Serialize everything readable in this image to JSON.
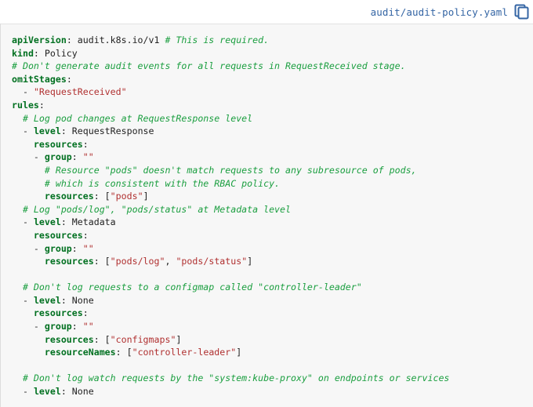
{
  "header": {
    "filename": "audit/audit-policy.yaml",
    "copy_label": "copy-to-clipboard",
    "filename_color": "#3465a4",
    "copy_icon_color": "#3465a4"
  },
  "code": {
    "language": "yaml",
    "background": "#f7f7f7",
    "colors": {
      "key": "#007020",
      "comment": "#1a9e3f",
      "string": "#b03030",
      "plain": "#222222"
    },
    "lines": [
      {
        "indent": 0,
        "tokens": [
          {
            "t": "key",
            "v": "apiVersion"
          },
          {
            "t": "plain",
            "v": ": audit.k8s.io/v1 "
          },
          {
            "t": "comment",
            "v": "# This is required."
          }
        ]
      },
      {
        "indent": 0,
        "tokens": [
          {
            "t": "key",
            "v": "kind"
          },
          {
            "t": "plain",
            "v": ": Policy"
          }
        ]
      },
      {
        "indent": 0,
        "tokens": [
          {
            "t": "comment",
            "v": "# Don't generate audit events for all requests in RequestReceived stage."
          }
        ]
      },
      {
        "indent": 0,
        "tokens": [
          {
            "t": "key",
            "v": "omitStages"
          },
          {
            "t": "plain",
            "v": ":"
          }
        ]
      },
      {
        "indent": 2,
        "tokens": [
          {
            "t": "punct",
            "v": "- "
          },
          {
            "t": "string",
            "v": "\"RequestReceived\""
          }
        ]
      },
      {
        "indent": 0,
        "tokens": [
          {
            "t": "key",
            "v": "rules"
          },
          {
            "t": "plain",
            "v": ":"
          }
        ]
      },
      {
        "indent": 2,
        "tokens": [
          {
            "t": "comment",
            "v": "# Log pod changes at RequestResponse level"
          }
        ]
      },
      {
        "indent": 2,
        "tokens": [
          {
            "t": "punct",
            "v": "- "
          },
          {
            "t": "key",
            "v": "level"
          },
          {
            "t": "plain",
            "v": ": RequestResponse"
          }
        ]
      },
      {
        "indent": 4,
        "tokens": [
          {
            "t": "key",
            "v": "resources"
          },
          {
            "t": "plain",
            "v": ":"
          }
        ]
      },
      {
        "indent": 4,
        "tokens": [
          {
            "t": "punct",
            "v": "- "
          },
          {
            "t": "key",
            "v": "group"
          },
          {
            "t": "plain",
            "v": ": "
          },
          {
            "t": "string",
            "v": "\"\""
          }
        ]
      },
      {
        "indent": 6,
        "tokens": [
          {
            "t": "comment",
            "v": "# Resource \"pods\" doesn't match requests to any subresource of pods,"
          }
        ]
      },
      {
        "indent": 6,
        "tokens": [
          {
            "t": "comment",
            "v": "# which is consistent with the RBAC policy."
          }
        ]
      },
      {
        "indent": 6,
        "tokens": [
          {
            "t": "key",
            "v": "resources"
          },
          {
            "t": "plain",
            "v": ": ["
          },
          {
            "t": "string",
            "v": "\"pods\""
          },
          {
            "t": "plain",
            "v": "]"
          }
        ]
      },
      {
        "indent": 2,
        "tokens": [
          {
            "t": "comment",
            "v": "# Log \"pods/log\", \"pods/status\" at Metadata level"
          }
        ]
      },
      {
        "indent": 2,
        "tokens": [
          {
            "t": "punct",
            "v": "- "
          },
          {
            "t": "key",
            "v": "level"
          },
          {
            "t": "plain",
            "v": ": Metadata"
          }
        ]
      },
      {
        "indent": 4,
        "tokens": [
          {
            "t": "key",
            "v": "resources"
          },
          {
            "t": "plain",
            "v": ":"
          }
        ]
      },
      {
        "indent": 4,
        "tokens": [
          {
            "t": "punct",
            "v": "- "
          },
          {
            "t": "key",
            "v": "group"
          },
          {
            "t": "plain",
            "v": ": "
          },
          {
            "t": "string",
            "v": "\"\""
          }
        ]
      },
      {
        "indent": 6,
        "tokens": [
          {
            "t": "key",
            "v": "resources"
          },
          {
            "t": "plain",
            "v": ": ["
          },
          {
            "t": "string",
            "v": "\"pods/log\""
          },
          {
            "t": "plain",
            "v": ", "
          },
          {
            "t": "string",
            "v": "\"pods/status\""
          },
          {
            "t": "plain",
            "v": "]"
          }
        ]
      },
      {
        "indent": 0,
        "tokens": []
      },
      {
        "indent": 2,
        "tokens": [
          {
            "t": "comment",
            "v": "# Don't log requests to a configmap called \"controller-leader\""
          }
        ]
      },
      {
        "indent": 2,
        "tokens": [
          {
            "t": "punct",
            "v": "- "
          },
          {
            "t": "key",
            "v": "level"
          },
          {
            "t": "plain",
            "v": ": None"
          }
        ]
      },
      {
        "indent": 4,
        "tokens": [
          {
            "t": "key",
            "v": "resources"
          },
          {
            "t": "plain",
            "v": ":"
          }
        ]
      },
      {
        "indent": 4,
        "tokens": [
          {
            "t": "punct",
            "v": "- "
          },
          {
            "t": "key",
            "v": "group"
          },
          {
            "t": "plain",
            "v": ": "
          },
          {
            "t": "string",
            "v": "\"\""
          }
        ]
      },
      {
        "indent": 6,
        "tokens": [
          {
            "t": "key",
            "v": "resources"
          },
          {
            "t": "plain",
            "v": ": ["
          },
          {
            "t": "string",
            "v": "\"configmaps\""
          },
          {
            "t": "plain",
            "v": "]"
          }
        ]
      },
      {
        "indent": 6,
        "tokens": [
          {
            "t": "key",
            "v": "resourceNames"
          },
          {
            "t": "plain",
            "v": ": ["
          },
          {
            "t": "string",
            "v": "\"controller-leader\""
          },
          {
            "t": "plain",
            "v": "]"
          }
        ]
      },
      {
        "indent": 0,
        "tokens": []
      },
      {
        "indent": 2,
        "tokens": [
          {
            "t": "comment",
            "v": "# Don't log watch requests by the \"system:kube-proxy\" on endpoints or services"
          }
        ]
      },
      {
        "indent": 2,
        "tokens": [
          {
            "t": "punct",
            "v": "- "
          },
          {
            "t": "key",
            "v": "level"
          },
          {
            "t": "plain",
            "v": ": None"
          }
        ]
      }
    ]
  }
}
